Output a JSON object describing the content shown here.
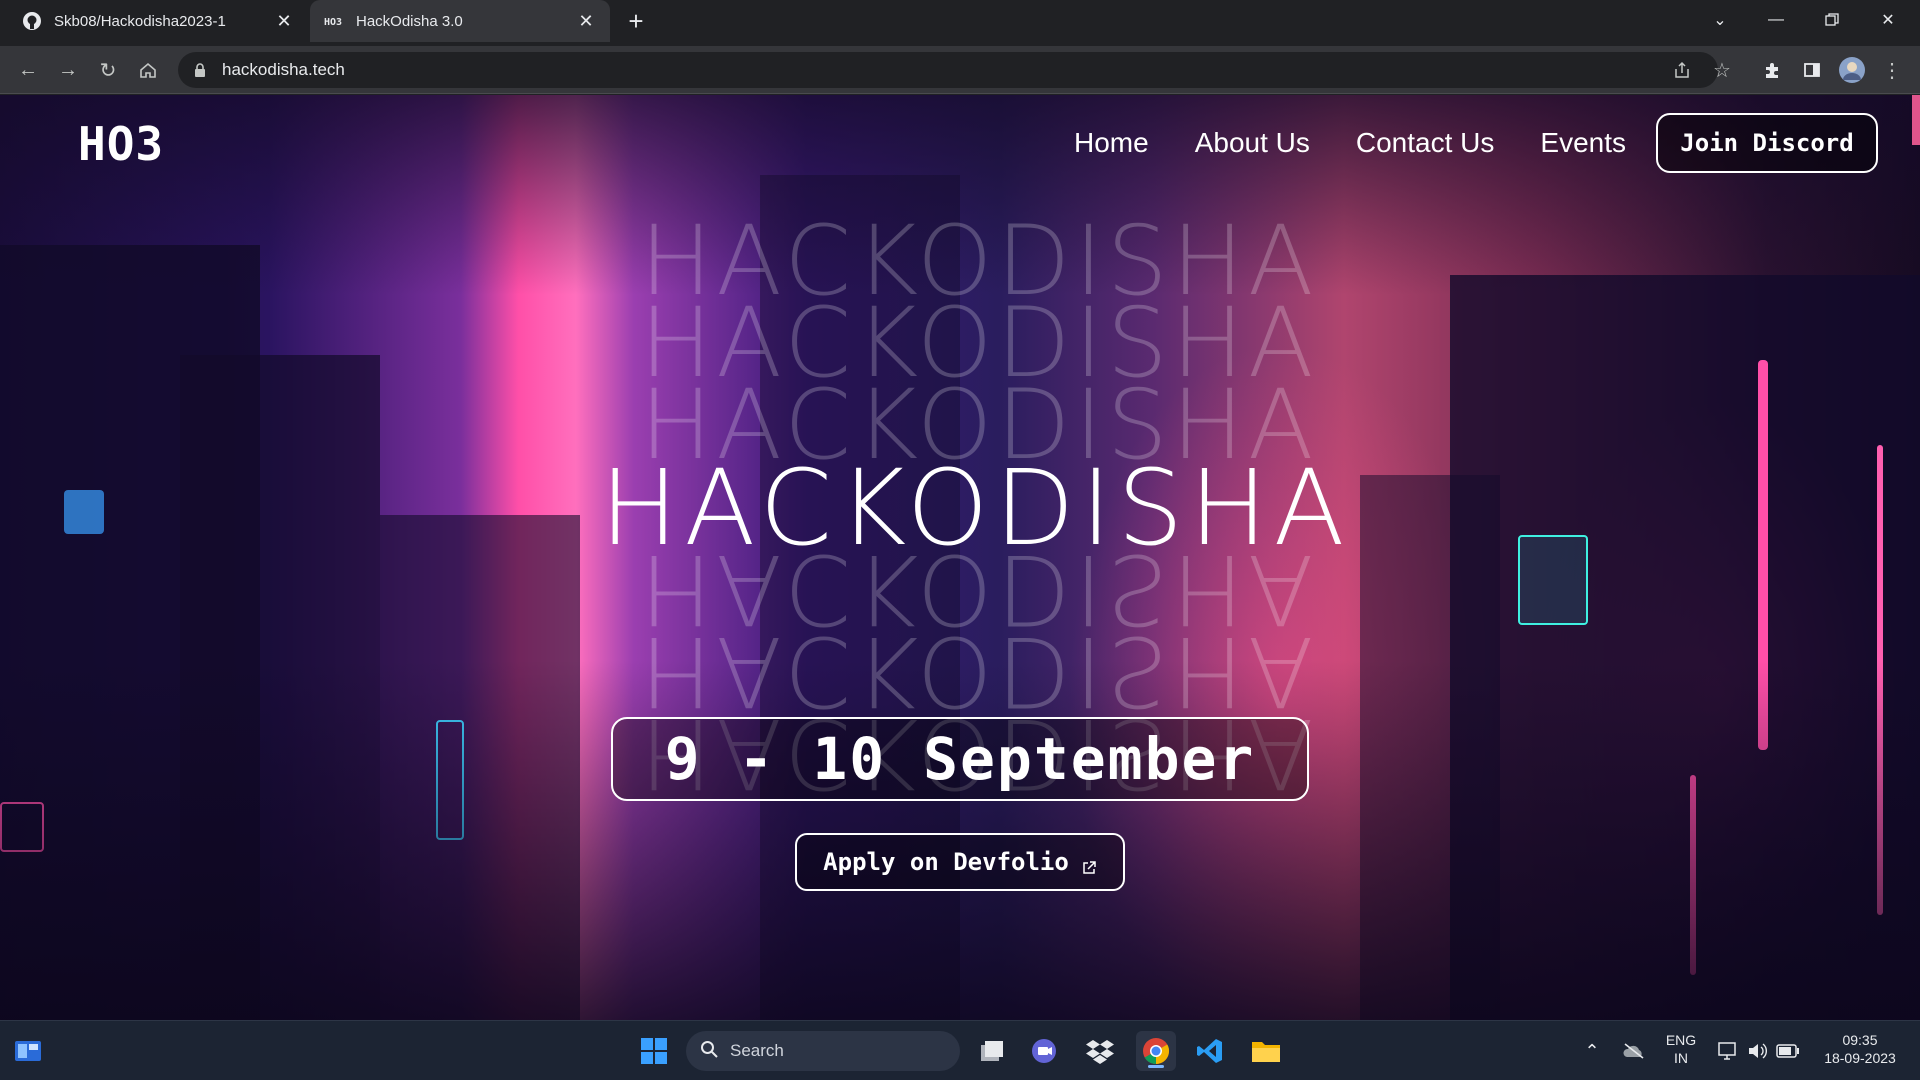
{
  "browser": {
    "tabs": [
      {
        "title": "Skb08/Hackodisha2023-1",
        "favicon": "github-icon",
        "active": false
      },
      {
        "title": "HackOdisha 3.0",
        "favicon": "ho3-favicon",
        "active": true
      }
    ],
    "new_tab": "+",
    "url": "hackodisha.tech"
  },
  "site": {
    "logo": "HO3",
    "nav": [
      {
        "label": "Home"
      },
      {
        "label": "About Us"
      },
      {
        "label": "Contact Us"
      },
      {
        "label": "Events"
      }
    ],
    "discord_button": "Join Discord",
    "hero_title": "HACKODISHA",
    "date": "9 - 10 September",
    "apply_button": "Apply on Devfolio",
    "accent_color": "#ff4fa8"
  },
  "taskbar": {
    "search_placeholder": "Search",
    "pinned": [
      "windows-start-icon",
      "task-view-icon",
      "teams-icon",
      "dropbox-icon",
      "chrome-icon",
      "vscode-icon",
      "file-explorer-icon"
    ],
    "language": {
      "line1": "ENG",
      "line2": "IN"
    },
    "time": "09:35",
    "date": "18-09-2023"
  }
}
